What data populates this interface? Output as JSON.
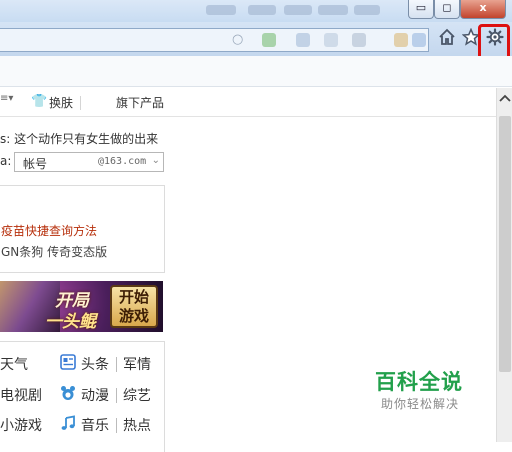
{
  "browser": {
    "window_buttons": {
      "minimize": "▭",
      "restore": "◻",
      "close": "x"
    },
    "toolbar_icons": [
      "home-icon",
      "favorites-star-icon",
      "settings-gear-icon"
    ],
    "highlight_color": "#dd1111"
  },
  "page": {
    "nav": {
      "skin_label": "换肤",
      "products_label": "旗下产品"
    },
    "mail": {
      "hint_prefix": "s:",
      "hint_text": "这个动作只有女生做的出来",
      "account_prefix": "a:",
      "account_placeholder": "帐号",
      "account_domain": "@163.com"
    },
    "info_card": {
      "link_red": "疫苗快捷查询方法",
      "links_line": "GN条狗 传奇变态版"
    },
    "banner": {
      "line1": "开局",
      "line2": "一头鲲",
      "button_line1": "开始",
      "button_line2": "游戏"
    },
    "quick_links": [
      [
        "天气",
        "头条",
        "军情"
      ],
      [
        "电视剧",
        "动漫",
        "综艺"
      ],
      [
        "小游戏",
        "音乐",
        "热点"
      ]
    ]
  },
  "watermark": {
    "title": "百科全说",
    "subtitle": "助你轻松解决"
  }
}
